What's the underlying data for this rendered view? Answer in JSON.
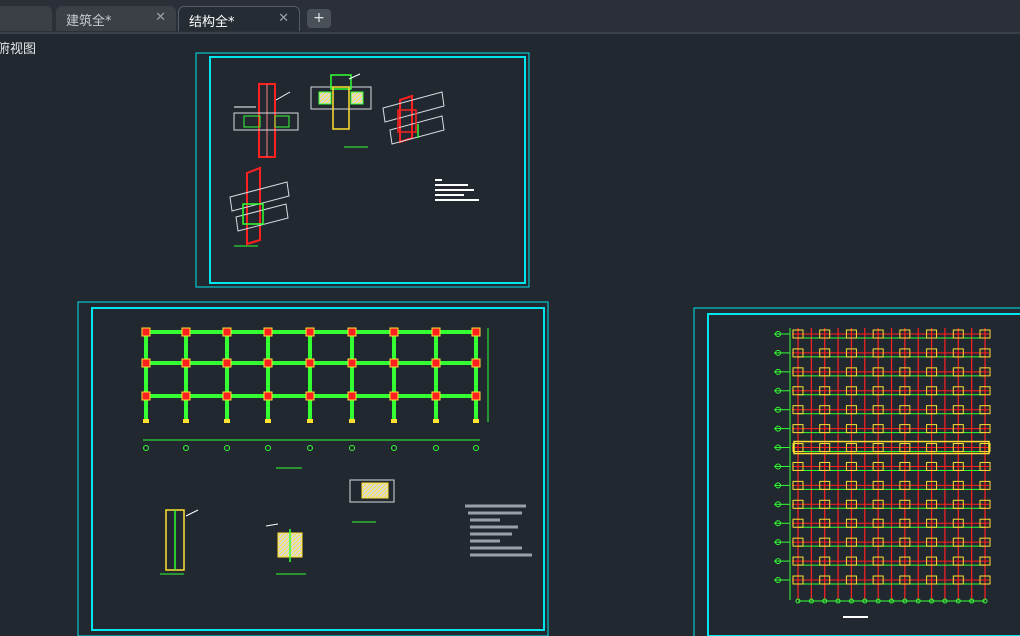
{
  "tabs": [
    {
      "label": "",
      "active": false
    },
    {
      "label": "建筑全*",
      "active": false
    },
    {
      "label": "结构全*",
      "active": true
    }
  ],
  "tab_close_glyph": "✕",
  "tab_add_glyph": "+",
  "viewport": {
    "label": "俯视图"
  },
  "colors": {
    "background": "#212830",
    "frame": "#00e5ee",
    "column": "#ff2020",
    "beam": "#33ff33",
    "annotation": "#ffffff",
    "hatch": "#ffe033"
  },
  "icons": [
    "close-icon",
    "plus-icon"
  ]
}
